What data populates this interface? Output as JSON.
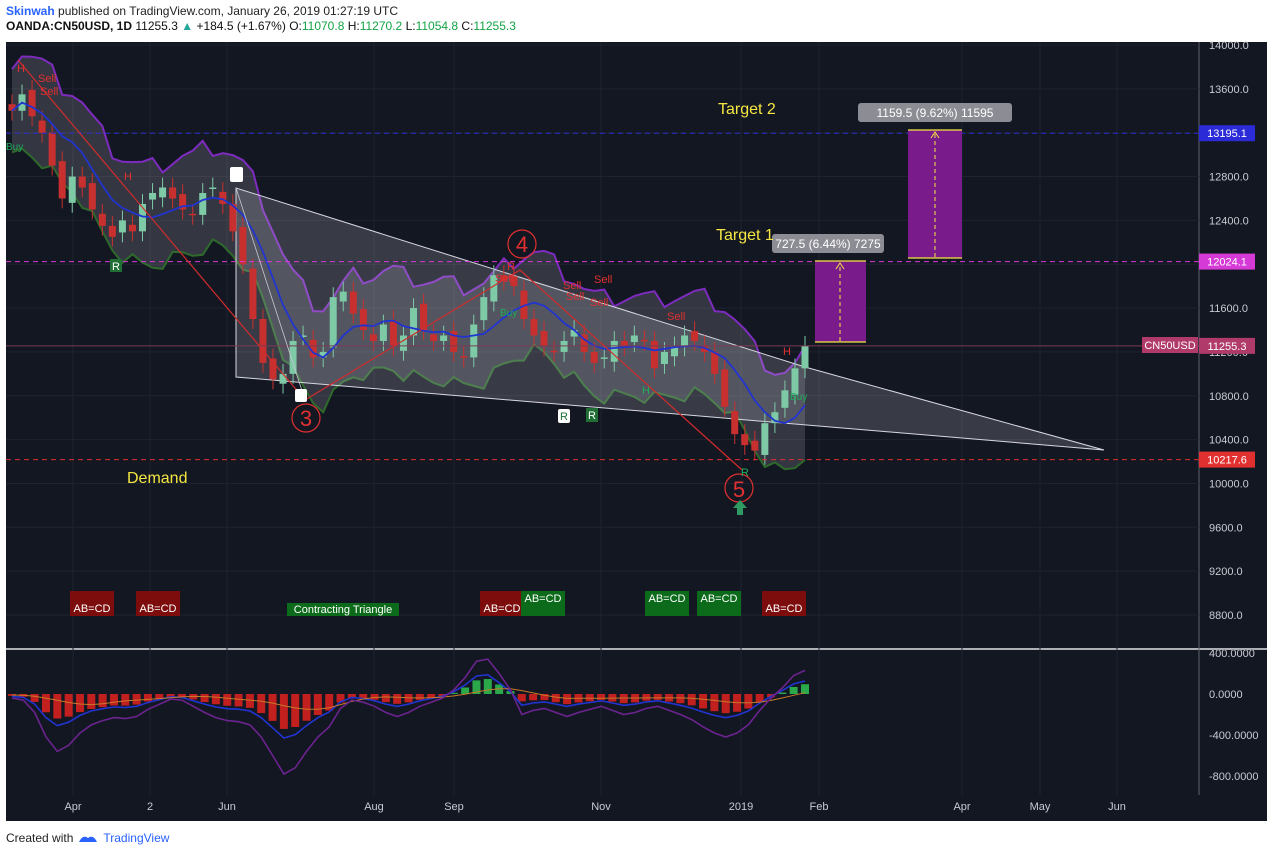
{
  "header": {
    "author": "Skinwah",
    "published": "published on TradingView.com, January 26, 2019 01:27:19 UTC",
    "symbol": "OANDA:CN50USD, 1D",
    "price": "11255.3",
    "change_arrow": "▲",
    "change": "+184.5 (+1.67%)",
    "o_label": "O:",
    "o": "11070.8",
    "h_label": "H:",
    "h": "11270.2",
    "l_label": "L:",
    "l": "11054.8",
    "c_label": "C:",
    "c": "11255.3"
  },
  "footer": {
    "created_with": "Created with",
    "brand": "TradingView"
  },
  "colors": {
    "background": "#131722",
    "grid": "#2a2e39",
    "up_candle": "#7ec9a6",
    "down_candle": "#c8302f",
    "bollinger": "#7e2bbf",
    "ma_line": "#2234d0",
    "target_box": "#7a1b8c",
    "support_line": "#e03030",
    "target2_line": "#2b2bd8",
    "target1_line": "#d63ad6"
  },
  "chart_data": {
    "type": "candlestick",
    "symbol": "CN50USD",
    "timeframe": "1D",
    "ylim": [
      9200,
      14000
    ],
    "y_ticks": [
      "14000.0",
      "13600.0",
      "13200.0",
      "12800.0",
      "12400.0",
      "12000.0",
      "11600.0",
      "11200.0",
      "10800.0",
      "10400.0",
      "10000.0",
      "9600.0",
      "9200.0",
      "8800.0"
    ],
    "y_tick_values": [
      14000,
      13600,
      13200,
      12800,
      12400,
      12000,
      11600,
      11200,
      10800,
      10400,
      10000,
      9600,
      9200,
      8800
    ],
    "x_ticks": [
      "Apr",
      "2",
      "Jun",
      "Aug",
      "Sep",
      "Nov",
      "2019",
      "Feb",
      "Apr",
      "May",
      "Jun"
    ],
    "price_labels": [
      {
        "text": "13195.1",
        "value": 13195.1,
        "color": "#2b2bd8"
      },
      {
        "text": "12024.1",
        "value": 12024.1,
        "color": "#d63ad6"
      },
      {
        "text": "11255.3",
        "value": 11255.3,
        "color": "#b03a6a",
        "tag": "CN50USD"
      },
      {
        "text": "10217.6",
        "value": 10217.6,
        "color": "#e03030"
      }
    ],
    "annotations": {
      "target2": "Target 2",
      "target1": "Target 1",
      "demand": "Demand",
      "target2_measure": "1159.5 (9.62%) 11595",
      "target1_measure": "727.5 (6.44%) 7275",
      "wave3": "3",
      "wave4": "4",
      "wave5": "5",
      "triangle_label": "Contracting Triangle",
      "abcd": "AB=CD",
      "sell": "Sell",
      "h": "H",
      "r": "R",
      "buy": "Buy"
    },
    "close_series": [
      13400,
      13550,
      13350,
      13200,
      12900,
      12600,
      12800,
      12700,
      12500,
      12350,
      12250,
      12400,
      12300,
      12550,
      12650,
      12700,
      12600,
      12500,
      12450,
      12650,
      12700,
      12550,
      12300,
      12000,
      11500,
      11100,
      10950,
      11000,
      11300,
      11350,
      11150,
      11200,
      11700,
      11750,
      11550,
      11400,
      11300,
      11450,
      11250,
      11350,
      11600,
      11400,
      11300,
      11350,
      11200,
      11150,
      11450,
      11700,
      11900,
      11850,
      11800,
      11500,
      11350,
      11250,
      11200,
      11300,
      11400,
      11200,
      11100,
      11150,
      11300,
      11250,
      11350,
      11300,
      11050,
      11200,
      11250,
      11350,
      11300,
      11200,
      11000,
      10700,
      10450,
      10350,
      10300,
      10550,
      10650,
      10850,
      11050,
      11255
    ],
    "oscillator": {
      "ylim": [
        -900,
        450
      ],
      "ticks": [
        "400.0000",
        "0.0000",
        "-400.0000",
        "-800.0000"
      ],
      "tick_values": [
        400,
        0,
        -400,
        -800
      ],
      "macd_series": [
        -40,
        -60,
        -180,
        -420,
        -560,
        -500,
        -380,
        -300,
        -260,
        -230,
        -240,
        -220,
        -150,
        -100,
        -50,
        -60,
        -120,
        -180,
        -230,
        -260,
        -270,
        -300,
        -420,
        -600,
        -780,
        -720,
        -560,
        -420,
        -320,
        -140,
        -60,
        -80,
        -120,
        -180,
        -220,
        -180,
        -120,
        -80,
        -40,
        40,
        160,
        320,
        340,
        200,
        40,
        -200,
        -160,
        -140,
        -180,
        -220,
        -180,
        -150,
        -120,
        -160,
        -200,
        -180,
        -140,
        -120,
        -160,
        -200,
        -250,
        -320,
        -380,
        -420,
        -380,
        -300,
        -160,
        -40,
        60,
        180,
        230
      ]
    }
  }
}
